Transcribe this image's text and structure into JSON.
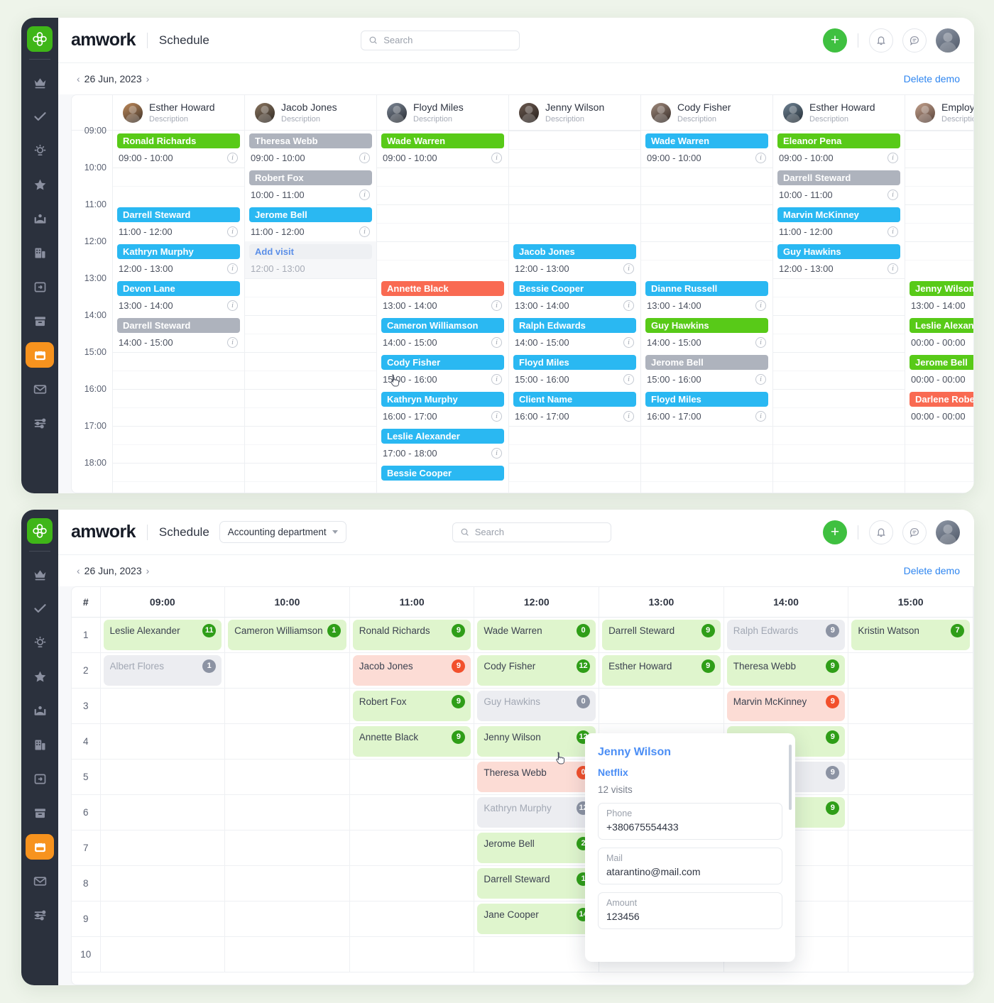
{
  "brand": "amwork",
  "header": {
    "page_title": "Schedule",
    "department": "Accounting department",
    "search_placeholder": "Search",
    "plus_label": "+",
    "icons": {
      "logo": "clover-logo-icon",
      "search": "search-icon",
      "bell": "bell-icon",
      "chat": "chat-icon",
      "avatar": "user-avatar"
    }
  },
  "datebar": {
    "prev": "‹",
    "date": "26 Jun, 2023",
    "next": "›",
    "delete_demo": "Delete demo"
  },
  "sidebar": {
    "items": [
      {
        "name": "crown-icon",
        "label": "Crown"
      },
      {
        "name": "check-icon",
        "label": "Tasks"
      },
      {
        "name": "lightbulb-icon",
        "label": "Ideas"
      },
      {
        "name": "star-icon",
        "label": "Favorites"
      },
      {
        "name": "contact-icon",
        "label": "Contacts"
      },
      {
        "name": "building-icon",
        "label": "Companies"
      },
      {
        "name": "import-icon",
        "label": "Import"
      },
      {
        "name": "archive-icon",
        "label": "Archive"
      },
      {
        "name": "calendar-icon",
        "label": "Schedule",
        "active": true
      },
      {
        "name": "mail-icon",
        "label": "Mail"
      },
      {
        "name": "sliders-icon",
        "label": "Settings"
      }
    ]
  },
  "calendar": {
    "time_labels": [
      "09:00",
      "10:00",
      "11:00",
      "12:00",
      "13:00",
      "14:00",
      "15:00",
      "16:00",
      "17:00",
      "18:00"
    ],
    "description_label": "Description",
    "add_visit_label": "Add visit",
    "columns": [
      {
        "name": "Esther Howard",
        "desc": "Description",
        "avatar": "a1",
        "events": [
          {
            "slot": 0,
            "title": "Ronald Richards",
            "time": "09:00 - 10:00",
            "color": "green"
          },
          {
            "slot": 2,
            "title": "Darrell Steward",
            "time": "11:00 - 12:00",
            "color": "blue"
          },
          {
            "slot": 3,
            "title": "Kathryn Murphy",
            "time": "12:00 - 13:00",
            "color": "blue"
          },
          {
            "slot": 4,
            "title": "Devon Lane",
            "time": "13:00 - 14:00",
            "color": "blue"
          },
          {
            "slot": 5,
            "title": "Darrell Steward",
            "time": "14:00 - 15:00",
            "color": "gray"
          }
        ]
      },
      {
        "name": "Jacob Jones",
        "desc": "Description",
        "avatar": "a2",
        "events": [
          {
            "slot": 0,
            "title": "Theresa Webb",
            "time": "09:00 - 10:00",
            "color": "gray"
          },
          {
            "slot": 1,
            "title": "Robert Fox",
            "time": "10:00 - 11:00",
            "color": "gray"
          },
          {
            "slot": 2,
            "title": "Jerome Bell",
            "time": "11:00 - 12:00",
            "color": "blue"
          },
          {
            "slot": 3,
            "title": "Add visit",
            "time": "12:00 - 13:00",
            "color": "ghost"
          }
        ]
      },
      {
        "name": "Floyd Miles",
        "desc": "Description",
        "avatar": "a3",
        "events": [
          {
            "slot": 0,
            "title": "Wade Warren",
            "time": "09:00 - 10:00",
            "color": "green"
          },
          {
            "slot": 4,
            "title": "Annette Black",
            "time": "13:00 - 14:00",
            "color": "red"
          },
          {
            "slot": 5,
            "title": "Cameron Williamson",
            "time": "14:00 - 15:00",
            "color": "blue"
          },
          {
            "slot": 6,
            "title": "Cody Fisher",
            "time": "15:00 - 16:00",
            "color": "blue"
          },
          {
            "slot": 7,
            "title": "Kathryn Murphy",
            "time": "16:00 - 17:00",
            "color": "blue"
          },
          {
            "slot": 8,
            "title": "Leslie Alexander",
            "time": "17:00 - 18:00",
            "color": "blue"
          },
          {
            "slot": 9,
            "title": "Bessie Cooper",
            "time": "",
            "color": "blue"
          }
        ]
      },
      {
        "name": "Jenny Wilson",
        "desc": "Description",
        "avatar": "a4",
        "events": [
          {
            "slot": 3,
            "title": "Jacob Jones",
            "time": "12:00 - 13:00",
            "color": "blue"
          },
          {
            "slot": 4,
            "title": "Bessie Cooper",
            "time": "13:00 - 14:00",
            "color": "blue"
          },
          {
            "slot": 5,
            "title": "Ralph Edwards",
            "time": "14:00 - 15:00",
            "color": "blue"
          },
          {
            "slot": 6,
            "title": "Floyd Miles",
            "time": "15:00 - 16:00",
            "color": "blue"
          },
          {
            "slot": 7,
            "title": "Client Name",
            "time": "16:00 - 17:00",
            "color": "blue"
          }
        ]
      },
      {
        "name": "Cody Fisher",
        "desc": "Description",
        "avatar": "a5",
        "events": [
          {
            "slot": 0,
            "title": "Wade Warren",
            "time": "09:00 - 10:00",
            "color": "blue"
          },
          {
            "slot": 4,
            "title": "Dianne Russell",
            "time": "13:00 - 14:00",
            "color": "blue"
          },
          {
            "slot": 5,
            "title": "Guy Hawkins",
            "time": "14:00 - 15:00",
            "color": "green"
          },
          {
            "slot": 6,
            "title": "Jerome Bell",
            "time": "15:00 - 16:00",
            "color": "gray"
          },
          {
            "slot": 7,
            "title": "Floyd Miles",
            "time": "16:00 - 17:00",
            "color": "blue"
          }
        ]
      },
      {
        "name": "Esther Howard",
        "desc": "Description",
        "avatar": "a6",
        "events": [
          {
            "slot": 0,
            "title": "Eleanor Pena",
            "time": "09:00 - 10:00",
            "color": "green"
          },
          {
            "slot": 1,
            "title": "Darrell Steward",
            "time": "10:00 - 11:00",
            "color": "gray"
          },
          {
            "slot": 2,
            "title": "Marvin McKinney",
            "time": "11:00 - 12:00",
            "color": "blue"
          },
          {
            "slot": 3,
            "title": "Guy Hawkins",
            "time": "12:00 - 13:00",
            "color": "blue"
          }
        ]
      },
      {
        "name": "Employee",
        "desc": "Description",
        "avatar": "a7",
        "events": [
          {
            "slot": 4,
            "title": "Jenny Wilson",
            "time": "13:00 - 14:00",
            "color": "green"
          },
          {
            "slot": 5,
            "title": "Leslie Alexander",
            "time": "00:00 - 00:00",
            "color": "green"
          },
          {
            "slot": 6,
            "title": "Jerome Bell",
            "time": "00:00 - 00:00",
            "color": "green"
          },
          {
            "slot": 7,
            "title": "Darlene Robertson",
            "time": "00:00 - 00:00",
            "color": "red"
          }
        ]
      }
    ]
  },
  "table": {
    "index_header": "#",
    "columns": [
      "09:00",
      "10:00",
      "11:00",
      "12:00",
      "13:00",
      "14:00",
      "15:00"
    ],
    "row_numbers": [
      "1",
      "2",
      "3",
      "4",
      "5",
      "6",
      "7",
      "8",
      "9",
      "10"
    ],
    "cells": [
      [
        {
          "name": "Leslie Alexander",
          "badge": "11",
          "color": "green"
        },
        {
          "name": "Cameron Williamson",
          "badge": "1",
          "color": "green"
        },
        {
          "name": "Ronald Richards",
          "badge": "9",
          "color": "green"
        },
        {
          "name": "Wade Warren",
          "badge": "0",
          "color": "green"
        },
        {
          "name": "Darrell Steward",
          "badge": "9",
          "color": "green"
        },
        {
          "name": "Ralph Edwards",
          "badge": "9",
          "color": "gray"
        },
        {
          "name": "Kristin Watson",
          "badge": "7",
          "color": "green"
        }
      ],
      [
        {
          "name": "Albert Flores",
          "badge": "1",
          "color": "gray"
        },
        null,
        {
          "name": "Jacob Jones",
          "badge": "9",
          "color": "red"
        },
        {
          "name": "Cody Fisher",
          "badge": "12",
          "color": "green"
        },
        {
          "name": "Esther Howard",
          "badge": "9",
          "color": "green"
        },
        {
          "name": "Theresa Webb",
          "badge": "9",
          "color": "green"
        },
        null
      ],
      [
        null,
        null,
        {
          "name": "Robert Fox",
          "badge": "9",
          "color": "green"
        },
        {
          "name": "Guy Hawkins",
          "badge": "0",
          "color": "gray"
        },
        null,
        {
          "name": "Marvin McKinney",
          "badge": "9",
          "color": "red"
        },
        null
      ],
      [
        null,
        null,
        {
          "name": "Annette Black",
          "badge": "9",
          "color": "green"
        },
        {
          "name": "Jenny Wilson",
          "badge": "12",
          "color": "green"
        },
        null,
        {
          "name": "",
          "badge": "9",
          "color": "green"
        },
        null
      ],
      [
        null,
        null,
        null,
        {
          "name": "Theresa Webb",
          "badge": "0",
          "color": "red"
        },
        null,
        {
          "name": "",
          "badge": "9",
          "color": "gray"
        },
        null
      ],
      [
        null,
        null,
        null,
        {
          "name": "Kathryn Murphy",
          "badge": "12",
          "color": "gray"
        },
        null,
        {
          "name": "",
          "badge": "9",
          "color": "green"
        },
        null
      ],
      [
        null,
        null,
        null,
        {
          "name": "Jerome Bell",
          "badge": "2",
          "color": "green"
        },
        null,
        null,
        null
      ],
      [
        null,
        null,
        null,
        {
          "name": "Darrell Steward",
          "badge": "1",
          "color": "green"
        },
        null,
        null,
        null
      ],
      [
        null,
        null,
        null,
        {
          "name": "Jane Cooper",
          "badge": "14",
          "color": "green"
        },
        null,
        null,
        null
      ],
      [
        null,
        null,
        null,
        null,
        null,
        null,
        null
      ]
    ]
  },
  "popup": {
    "title": "Jenny Wilson",
    "company": "Netflix",
    "visits": "12 visits",
    "fields": [
      {
        "label": "Phone",
        "value": "+380675554433"
      },
      {
        "label": "Mail",
        "value": "atarantino@mail.com"
      },
      {
        "label": "Amount",
        "value": "123456"
      }
    ]
  },
  "colors": {
    "green": "#58ca18",
    "blue": "#2ab8f2",
    "gray": "#aeb3bd",
    "red": "#f96a52",
    "accent_orange": "#f7931e",
    "link_blue": "#2f86f0"
  }
}
